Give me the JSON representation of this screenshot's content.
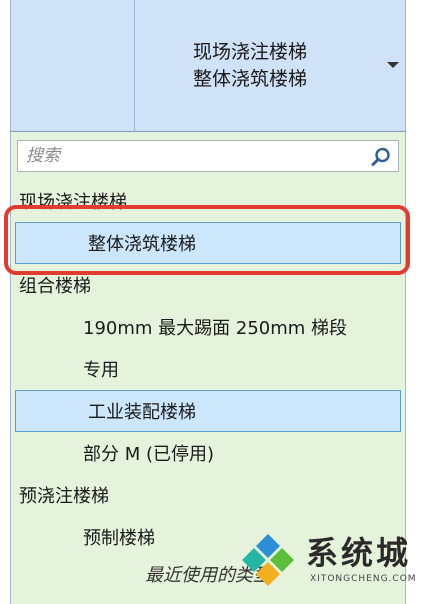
{
  "type_selector": {
    "family": "现场浇注楼梯",
    "type": "整体浇筑楼梯"
  },
  "search": {
    "placeholder": "搜索"
  },
  "list_rows": [
    {
      "kind": "group",
      "label": "现场浇注楼梯",
      "name": "group-cast-in-place-stair"
    },
    {
      "kind": "item",
      "label": "整体浇筑楼梯",
      "selected": true,
      "name": "list-item-monolithic-stair"
    },
    {
      "kind": "group",
      "label": "组合楼梯",
      "name": "group-assembled-stair"
    },
    {
      "kind": "item",
      "label": "190mm 最大踢面 250mm 梯段",
      "name": "list-item-190mm-riser"
    },
    {
      "kind": "item",
      "label": "专用",
      "name": "list-item-dedicated"
    },
    {
      "kind": "item",
      "label": "工业装配楼梯",
      "selected": true,
      "name": "list-item-industrial-assembled-stair"
    },
    {
      "kind": "item",
      "label": "部分 M (已停用)",
      "name": "list-item-part-m-disabled"
    },
    {
      "kind": "group",
      "label": "预浇注楼梯",
      "name": "group-precast-stair"
    },
    {
      "kind": "item",
      "label": "预制楼梯",
      "name": "list-item-prefab-stair"
    },
    {
      "kind": "section",
      "label": "最近使用的类型",
      "name": "recent-types-header"
    }
  ],
  "watermark": {
    "title": "系统城",
    "subtitle": "XITONGCHENG.COM"
  },
  "colors": {
    "list_background": "#e6f3dc",
    "header_background": "#cfe2f7",
    "selection": "#cce6fb",
    "annotation_red": "#e13b32"
  }
}
